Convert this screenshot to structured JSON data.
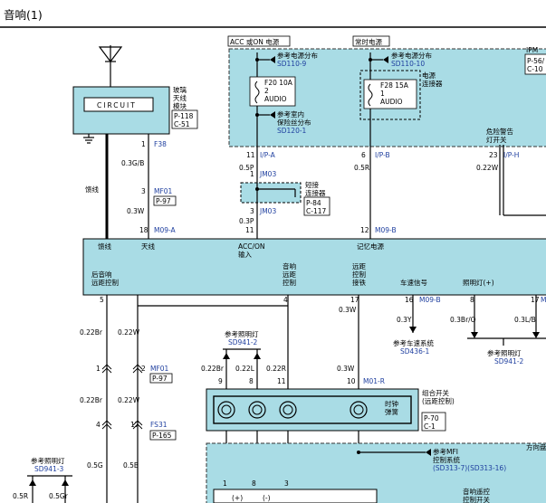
{
  "page_title": "音响(1)",
  "top_labels": {
    "acc_on_power": "ACC 或ON 电源",
    "memory_power": "常时电源"
  },
  "ipm": {
    "name": "IPM",
    "ref1": "P-56/",
    "ref2": "C-10"
  },
  "power_dist_left": {
    "label": "参考电源分布",
    "ref": "SD110-9"
  },
  "power_dist_right": {
    "label": "参考电源分布",
    "ref": "SD110-10"
  },
  "fuse_left": {
    "rating": "F20 10A",
    "pin": "2",
    "name": "AUDIO"
  },
  "fuse_right": {
    "rating": "F28 15A",
    "pin": "1",
    "name": "AUDIO"
  },
  "power_connector": "电源\n连接器",
  "indoor_fuse": {
    "label": "参考室内\n保险丝分布",
    "ref": "SD120-1"
  },
  "hazard_switch": "危险警告\n灯开关",
  "circuit_module": {
    "inner": "CIRCUIT",
    "name": "玻璃\n天线\n模块",
    "ref1": "P-118",
    "ref2": "C-51"
  },
  "short_connector": {
    "name": "短接\n连接器",
    "ref1": "P-84",
    "ref2": "C-117"
  },
  "feeder": "馈线",
  "wires": {
    "f38": {
      "pin": "1",
      "name": "F38",
      "color": "0.3G/B"
    },
    "mf01_top": {
      "pin": "3",
      "name": "MF01",
      "ref": "P-97",
      "color": "0.3W"
    },
    "m09a": {
      "pin": "18",
      "name": "M09-A"
    },
    "ipa": {
      "pin": "11",
      "name": "I/P-A",
      "color": "0.5P"
    },
    "jm03_top": {
      "pin": "1",
      "name": "JM03"
    },
    "jm03_bot": {
      "pin": "3",
      "name": "JM03",
      "color": "0.3P"
    },
    "acc_pin": "11",
    "ipb": {
      "pin": "6",
      "name": "I/P-B",
      "color": "0.5R"
    },
    "m09b_top": {
      "pin": "12",
      "name": "M09-B"
    },
    "iph": {
      "pin": "23",
      "name": "I/P-H",
      "color": "0.22W"
    }
  },
  "unit_labels": {
    "feeder": "馈线",
    "antenna": "天线",
    "acc_on_input": "ACC/ON\n输入",
    "memory_power": "记忆电源",
    "rear_speaker_remote": "后音响\n远距控制",
    "audio_remote": "音响\n远距\n控制",
    "remote_shift": "远距\n控制\n接铁",
    "speed_signal": "车速信号",
    "illum_plus": "照明灯(+)"
  },
  "pins": {
    "p5": "5",
    "p4": "4",
    "p17": "17",
    "p16": "16",
    "p8": "8",
    "p17r": "17"
  },
  "speed_wire": {
    "name": "M09-B",
    "color": "0.3Y"
  },
  "lower_colors": {
    "c_0_3w_1": "0.3W",
    "c_0_3br_o": "0.3Br/O",
    "c_0_3l_b": "0.3L/B"
  },
  "ref_speed_system": {
    "label": "参考车速系统",
    "ref": "SD436-1"
  },
  "ref_illum_right": {
    "label": "参考照明灯",
    "ref": "SD941-2"
  },
  "ref_illum_mid": {
    "label": "参考照明灯",
    "ref": "SD941-2"
  },
  "left_wires": {
    "c1": "0.22Br",
    "c2": "0.22W",
    "c3": "0.22Br",
    "c4": "0.22W",
    "c5": "0.5G",
    "c6": "0.5B"
  },
  "mf01_lower": {
    "pin_l": "1",
    "pin_r": "2",
    "name": "MF01",
    "ref": "P-97"
  },
  "fs31": {
    "pin_l": "4",
    "pin_r": "17",
    "name": "FS31",
    "ref": "P-165"
  },
  "switch_wires": {
    "c1": "0.22Br",
    "c2": "0.22L",
    "c3": "0.22R",
    "c4": "0.3W"
  },
  "switch_pins": {
    "p9": "9",
    "p8": "8",
    "p11": "11",
    "p10": "10"
  },
  "m01r": "M01-R",
  "combo_switch": {
    "name": "组合开关\n(远距控制)",
    "ref1": "P-70",
    "ref2": "C-1",
    "clock_spring": "时钟\n弹簧"
  },
  "ref_mfi": {
    "label": "参考MFI\n控制系统",
    "ref": "(SD313-7)(SD313-16)"
  },
  "steering": "方向盘",
  "ref_illum_left": {
    "label": "参考照明灯",
    "ref": "SD941-3"
  },
  "bottom_left_colors": {
    "c1": "0.5R",
    "c2": "0.5Gr"
  },
  "bottom_pins": {
    "p1": "1",
    "p8": "8",
    "p3": "3"
  },
  "bottom_plus": "(+)",
  "bottom_minus": "(-)",
  "bottom_right_label": "音响遥控\n控制开关"
}
